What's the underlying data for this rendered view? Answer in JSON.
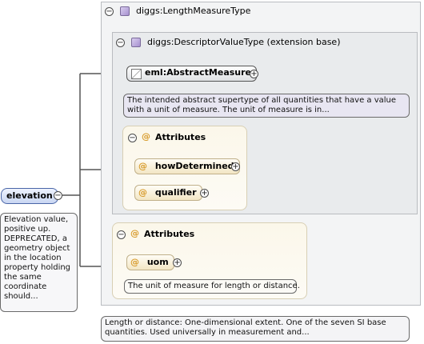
{
  "length_measure_type": {
    "label": "diggs:LengthMeasureType",
    "collapse": "−"
  },
  "descriptor_value_type": {
    "label": "diggs:DescriptorValueType (extension base)",
    "collapse": "−"
  },
  "abstract_measure": {
    "label": "eml:AbstractMeasure",
    "expand": "+",
    "doc": "The intended abstract supertype of all quantities that have a value with a unit of measure. The unit of measure is in..."
  },
  "inner_attributes": {
    "label": "Attributes",
    "collapse": "−",
    "at_symbol": "@",
    "items": [
      {
        "label": "howDetermined",
        "expand": "+"
      },
      {
        "label": "qualifier",
        "expand": "+"
      }
    ]
  },
  "outer_attributes": {
    "label": "Attributes",
    "collapse": "−",
    "at_symbol": "@",
    "items": [
      {
        "label": "uom",
        "expand": "+",
        "doc": "The unit of measure for length or distance."
      }
    ]
  },
  "elevation": {
    "label": "elevation",
    "collapse": "−",
    "doc": "Elevation value, positive up. DEPRECATED, a geometry object in the location property holding the same coordinate should..."
  },
  "type_doc": "Length or distance: One-dimensional extent. One of the seven SI base quantities. Used universally in measurement and..."
}
